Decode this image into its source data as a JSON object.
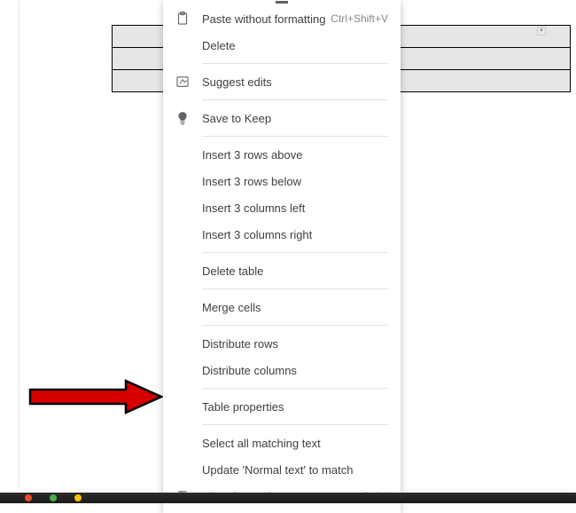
{
  "menu": {
    "paste_without_formatting": {
      "label": "Paste without formatting",
      "shortcut": "Ctrl+Shift+V"
    },
    "delete": {
      "label": "Delete"
    },
    "suggest_edits": {
      "label": "Suggest edits"
    },
    "save_to_keep": {
      "label": "Save to Keep"
    },
    "insert_rows_above": {
      "label": "Insert 3 rows above"
    },
    "insert_rows_below": {
      "label": "Insert 3 rows below"
    },
    "insert_cols_left": {
      "label": "Insert 3 columns left"
    },
    "insert_cols_right": {
      "label": "Insert 3 columns right"
    },
    "delete_table": {
      "label": "Delete table"
    },
    "merge_cells": {
      "label": "Merge cells"
    },
    "distribute_rows": {
      "label": "Distribute rows"
    },
    "distribute_columns": {
      "label": "Distribute columns"
    },
    "table_properties": {
      "label": "Table properties"
    },
    "select_matching": {
      "label": "Select all matching text"
    },
    "update_normal": {
      "label": "Update 'Normal text' to match"
    },
    "clear_formatting": {
      "label": "Clear formatting",
      "shortcut": "Ctrl+\\"
    }
  }
}
